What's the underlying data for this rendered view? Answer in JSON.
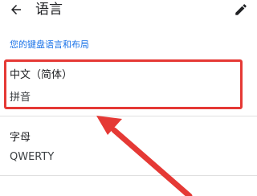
{
  "header": {
    "title": "语言",
    "back_icon": "arrow-left-icon",
    "edit_icon": "pencil-icon"
  },
  "section": {
    "title": "您的键盘语言和布局"
  },
  "languages": [
    {
      "name": "中文（简体）",
      "layout": "拼音"
    },
    {
      "name": "字母",
      "layout": "QWERTY"
    }
  ],
  "colors": {
    "accent": "#1a73e8",
    "annotation": "#e53935"
  }
}
